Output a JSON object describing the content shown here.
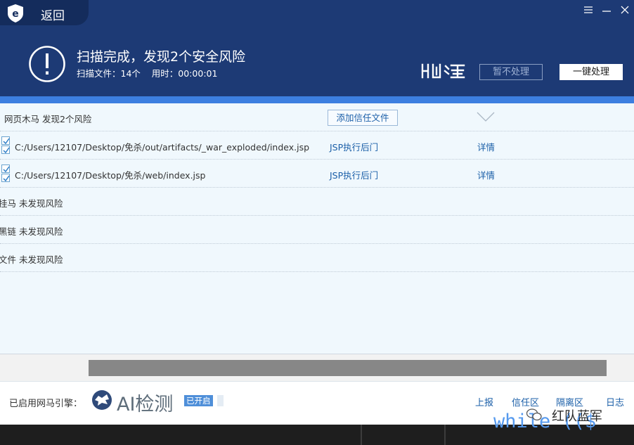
{
  "window": {
    "back_label": "返回",
    "controls": [
      {
        "name": "menu-icon"
      },
      {
        "name": "minimize-icon"
      },
      {
        "name": "close-icon"
      }
    ]
  },
  "summary": {
    "title": "扫描完成，发现2个安全风险",
    "info": "扫描文件：14个    用时：00:00:01",
    "ignore_label": "暂不处理",
    "fix_label": "一键处理"
  },
  "list": {
    "group_title": "网页木马 发现2个风险",
    "trust_label": "添加信任文件",
    "items": [
      {
        "path": "C:/Users/12107/Desktop/免杀/out/artifacts/_war_exploded/index.jsp",
        "type": "JSP执行后门",
        "action": "详情",
        "checked": true
      },
      {
        "path": "C:/Users/12107/Desktop/免杀/web/index.jsp",
        "type": "JSP执行后门",
        "action": "详情",
        "checked": true
      }
    ],
    "other_groups": [
      "挂马 未发现风险",
      "黑链 未发现风险",
      "文件 未发现风险"
    ]
  },
  "footer": {
    "engine_label": "已启用网马引擎：",
    "ai_title": "AI检测",
    "ai_badge": "已开启",
    "links": [
      "上报",
      "信任区",
      "隔离区",
      "日志"
    ]
  },
  "background": {
    "code_text": "while (($",
    "watermark": "红队蓝军"
  },
  "colors": {
    "header": "#1d3a75",
    "accent": "#3d7fe0",
    "link": "#1b5fa8"
  }
}
